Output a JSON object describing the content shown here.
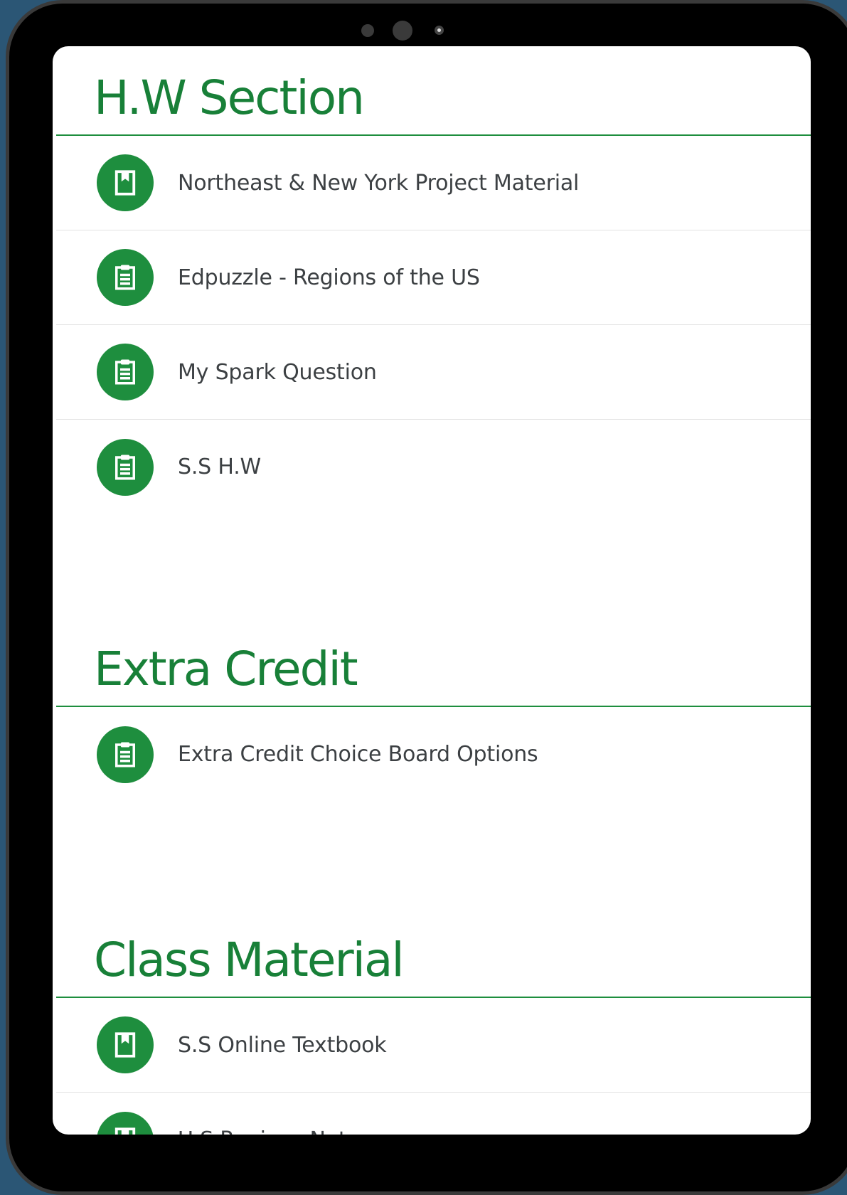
{
  "sections": [
    {
      "title": "H.W Section",
      "items": [
        {
          "label": "Northeast & New York Project Material",
          "icon": "book-icon"
        },
        {
          "label": "Edpuzzle - Regions of the US",
          "icon": "assignment-icon"
        },
        {
          "label": "My Spark Question",
          "icon": "assignment-icon"
        },
        {
          "label": "S.S H.W",
          "icon": "assignment-icon"
        }
      ]
    },
    {
      "title": "Extra Credit",
      "items": [
        {
          "label": "Extra Credit Choice Board Options",
          "icon": "assignment-icon"
        }
      ]
    },
    {
      "title": "Class Material",
      "items": [
        {
          "label": "S.S Online Textbook",
          "icon": "book-icon"
        },
        {
          "label": "U.S Regions Notes",
          "icon": "book-icon"
        }
      ]
    }
  ],
  "colors": {
    "accent": "#1e8e3e",
    "title": "#188038",
    "text": "#3c4043",
    "divider": "#e2e2e2",
    "backdrop": "#2b5675"
  }
}
